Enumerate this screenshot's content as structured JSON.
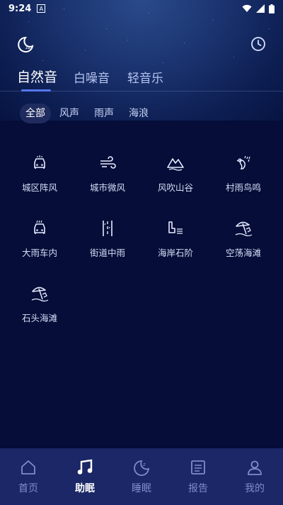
{
  "status_bar": {
    "time": "9:24",
    "notification_icon": "a-box-icon",
    "wifi_icon": "wifi-icon",
    "signal_icon": "signal-icon",
    "battery_icon": "battery-icon"
  },
  "header": {
    "left_icon": "moon-icon",
    "right_icon": "clock-icon"
  },
  "tabs": [
    {
      "label": "自然音",
      "active": true
    },
    {
      "label": "白噪音",
      "active": false
    },
    {
      "label": "轻音乐",
      "active": false
    }
  ],
  "chips": [
    {
      "label": "全部",
      "active": true
    },
    {
      "label": "风声",
      "active": false
    },
    {
      "label": "雨声",
      "active": false
    },
    {
      "label": "海浪",
      "active": false
    }
  ],
  "sounds": [
    {
      "label": "城区阵风",
      "icon": "car-icon"
    },
    {
      "label": "城市微风",
      "icon": "wind-icon"
    },
    {
      "label": "风吹山谷",
      "icon": "mountain-icon"
    },
    {
      "label": "村雨鸟鸣",
      "icon": "bird-rain-icon"
    },
    {
      "label": "大雨车内",
      "icon": "car-rain-icon"
    },
    {
      "label": "街道中雨",
      "icon": "street-icon"
    },
    {
      "label": "海岸石阶",
      "icon": "steps-icon"
    },
    {
      "label": "空荡海滩",
      "icon": "beach-umbrella-icon"
    },
    {
      "label": "石头海滩",
      "icon": "beach-umbrella-icon"
    }
  ],
  "bottom_nav": [
    {
      "label": "首页",
      "icon": "home-icon",
      "active": false
    },
    {
      "label": "助眠",
      "icon": "music-note-icon",
      "active": true
    },
    {
      "label": "睡眠",
      "icon": "moon-zz-icon",
      "active": false
    },
    {
      "label": "报告",
      "icon": "report-icon",
      "active": false
    },
    {
      "label": "我的",
      "icon": "person-icon",
      "active": false
    }
  ],
  "colors": {
    "accent": "#5577ee",
    "background": "#050d38",
    "nav_background": "#1b2766"
  }
}
